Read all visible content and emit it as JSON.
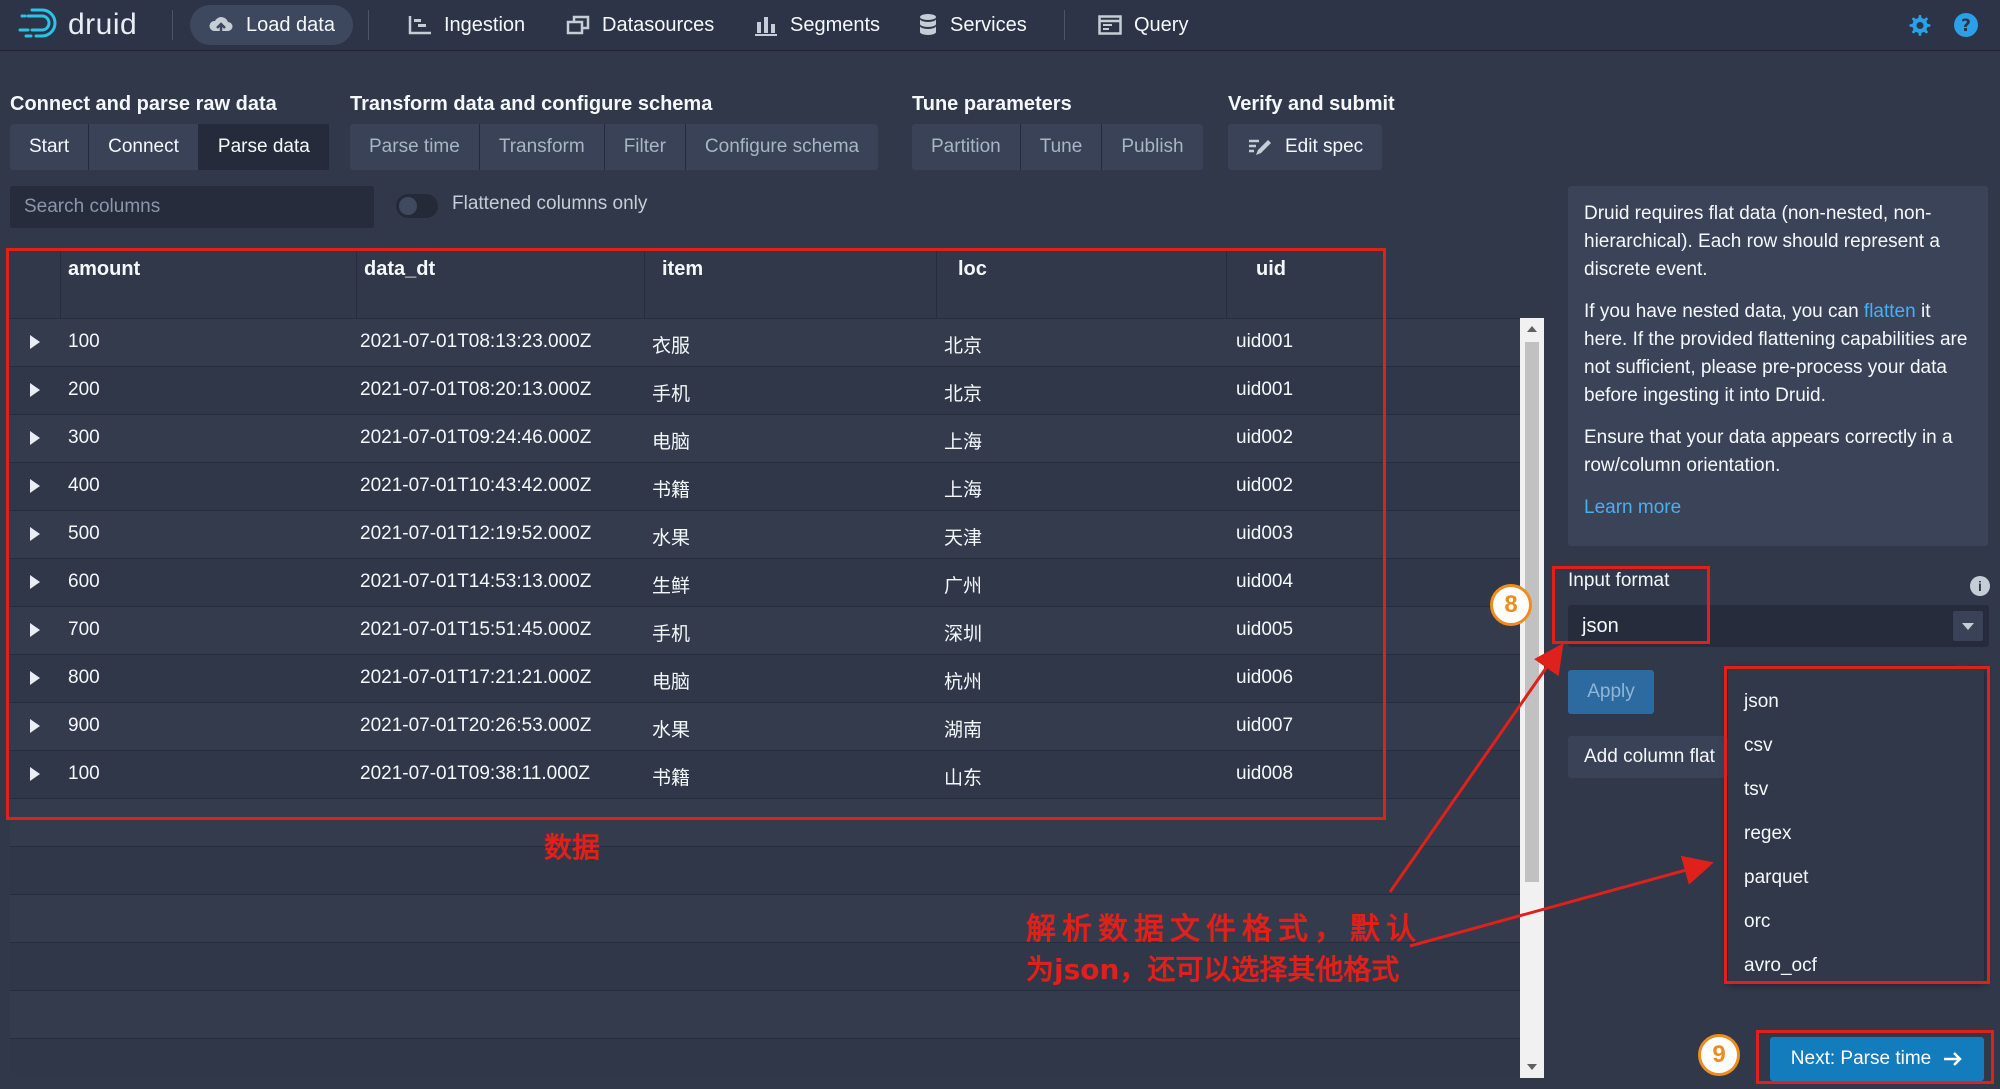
{
  "brand": {
    "name": "druid"
  },
  "nav": {
    "load_data": "Load data",
    "ingestion": "Ingestion",
    "datasources": "Datasources",
    "segments": "Segments",
    "services": "Services",
    "query": "Query"
  },
  "steps": {
    "group1": {
      "title": "Connect and parse raw data",
      "items": [
        "Start",
        "Connect",
        "Parse data"
      ]
    },
    "group2": {
      "title": "Transform data and configure schema",
      "items": [
        "Parse time",
        "Transform",
        "Filter",
        "Configure schema"
      ]
    },
    "group3": {
      "title": "Tune parameters",
      "items": [
        "Partition",
        "Tune",
        "Publish"
      ]
    },
    "group4": {
      "title": "Verify and submit",
      "items": [
        "Edit spec"
      ]
    }
  },
  "search": {
    "placeholder": "Search columns"
  },
  "flatten_toggle": {
    "label": "Flattened columns only",
    "on": false
  },
  "table": {
    "columns": [
      "amount",
      "data_dt",
      "item",
      "loc",
      "uid"
    ],
    "rows": [
      [
        "100",
        "2021-07-01T08:13:23.000Z",
        "衣服",
        "北京",
        "uid001"
      ],
      [
        "200",
        "2021-07-01T08:20:13.000Z",
        "手机",
        "北京",
        "uid001"
      ],
      [
        "300",
        "2021-07-01T09:24:46.000Z",
        "电脑",
        "上海",
        "uid002"
      ],
      [
        "400",
        "2021-07-01T10:43:42.000Z",
        "书籍",
        "上海",
        "uid002"
      ],
      [
        "500",
        "2021-07-01T12:19:52.000Z",
        "水果",
        "天津",
        "uid003"
      ],
      [
        "600",
        "2021-07-01T14:53:13.000Z",
        "生鲜",
        "广州",
        "uid004"
      ],
      [
        "700",
        "2021-07-01T15:51:45.000Z",
        "手机",
        "深圳",
        "uid005"
      ],
      [
        "800",
        "2021-07-01T17:21:21.000Z",
        "电脑",
        "杭州",
        "uid006"
      ],
      [
        "900",
        "2021-07-01T20:26:53.000Z",
        "水果",
        "湖南",
        "uid007"
      ],
      [
        "100",
        "2021-07-01T09:38:11.000Z",
        "书籍",
        "山东",
        "uid008"
      ]
    ]
  },
  "info": {
    "p1": "Druid requires flat data (non-nested, non-hierarchical). Each row should represent a discrete event.",
    "p2_before": "If you have nested data, you can ",
    "p2_link": "flatten",
    "p2_after": " it here. If the provided flattening capabilities are not sufficient, please pre-process your data before ingesting it into Druid.",
    "p3": "Ensure that your data appears correctly in a row/column orientation.",
    "learn_more": "Learn more"
  },
  "input_format": {
    "label": "Input format",
    "value": "json",
    "options": [
      "json",
      "csv",
      "tsv",
      "regex",
      "parquet",
      "orc",
      "avro_ocf"
    ]
  },
  "buttons": {
    "apply": "Apply",
    "add_column_flattening": "Add column flat",
    "next": "Next: Parse time"
  },
  "annotations": {
    "data_label": "数据",
    "format_note_line1": "解析数据文件格式，默认",
    "format_note_line2": "为json，还可以选择其他格式",
    "step8": "8",
    "step9": "9"
  },
  "colors": {
    "background": "#30384a",
    "topbar": "#2d3447",
    "primary_button": "#137cbd",
    "link": "#48aff0",
    "annotation_red": "#e0201b",
    "step_circle": "#f08c1c"
  },
  "icons": {
    "logo": "druid-logo-icon",
    "load_data": "cloud-upload-icon",
    "ingestion": "gantt-chart-icon",
    "datasources": "multi-select-icon",
    "segments": "stacked-chart-icon",
    "services": "database-icon",
    "query": "application-icon",
    "settings": "gear-icon",
    "help": "help-icon",
    "edit_spec": "edit-spec-icon",
    "next": "arrow-right-icon",
    "info": "info-icon",
    "dropdown": "caret-down-icon"
  }
}
